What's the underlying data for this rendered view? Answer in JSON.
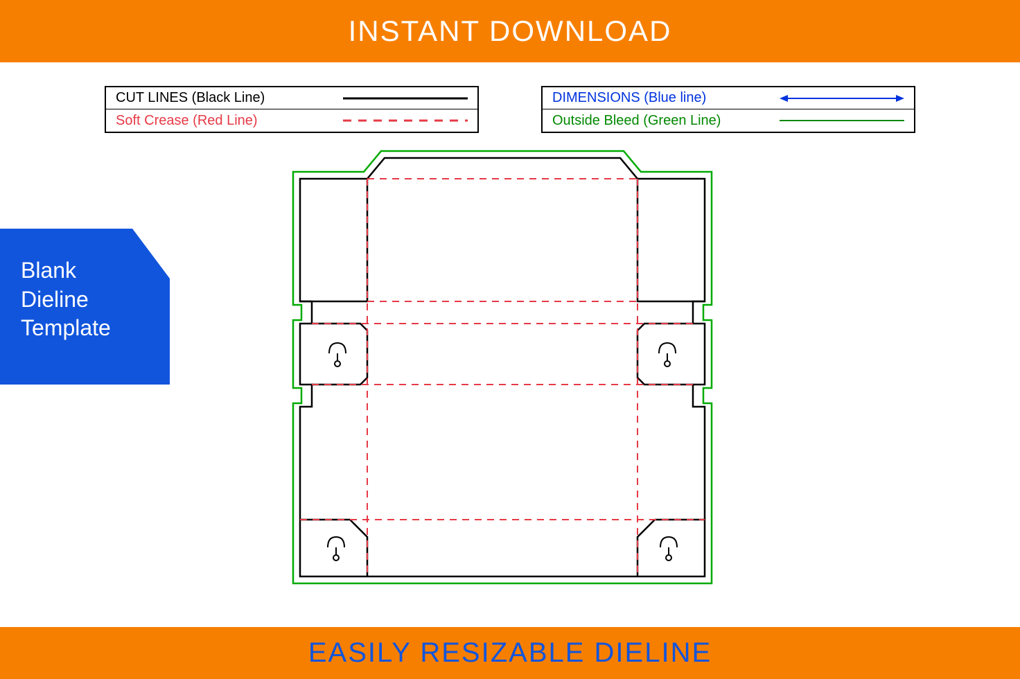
{
  "header": {
    "title": "INSTANT DOWNLOAD"
  },
  "legend": {
    "left": [
      {
        "label": "CUT LINES (Black Line)",
        "color": "#000000",
        "style": "solid"
      },
      {
        "label": "Soft Crease (Red Line)",
        "color": "#e63946",
        "style": "dashed"
      }
    ],
    "right": [
      {
        "label": "DIMENSIONS (Blue line)",
        "color": "#0033dd",
        "style": "arrow"
      },
      {
        "label": "Outside Bleed (Green Line)",
        "color": "#008800",
        "style": "solid"
      }
    ]
  },
  "badge": {
    "line1": "Blank",
    "line2": "Dieline",
    "line3": "Template"
  },
  "footer": {
    "title": "EASILY RESIZABLE DIELINE"
  },
  "diagram": {
    "description": "Box dieline template with outside bleed (green), cut lines (black), soft crease (red dashed) showing unfolded box layout with tabs and lock slots"
  }
}
